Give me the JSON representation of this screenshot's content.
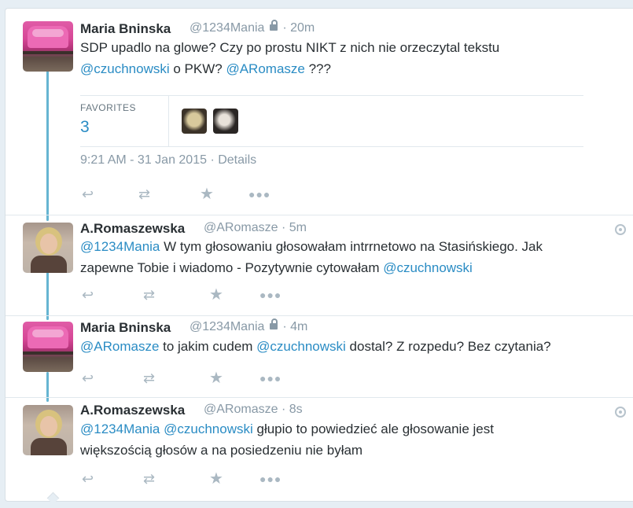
{
  "tweets": [
    {
      "name": "Maria Bninska",
      "handle": "@1234Mania",
      "time": "· 20m",
      "text": [
        {
          "t": "SDP upadlo na glowe? Czy po prostu NIKT z nich nie orzeczytal tekstu ",
          "m": false
        },
        {
          "t": "@czuchnowski",
          "m": true
        },
        {
          "t": " o PKW? ",
          "m": false
        },
        {
          "t": "@ARomasze",
          "m": true
        },
        {
          "t": " ???",
          "m": false
        }
      ],
      "favorites_label": "FAVORITES",
      "favorites_count": "3",
      "timestamp": "9:21 AM - 31 Jan 2015",
      "details": "· Details"
    },
    {
      "name": "A.Romaszewska",
      "handle": "@ARomasze",
      "time": "· 5m",
      "text_line1": [
        {
          "t": "@1234Mania",
          "m": true
        },
        {
          "t": " W tym głosowaniu głosowałam intrrnetowo na Stasińskiego.  Jak",
          "m": false
        }
      ],
      "text_line2": [
        {
          "t": "zapewne Tobie i  wiadomo - Pozytywnie cytowałam ",
          "m": false
        },
        {
          "t": "@czuchnowski",
          "m": true
        }
      ]
    },
    {
      "name": "Maria Bninska",
      "handle": "@1234Mania",
      "time": "· 4m",
      "text": [
        {
          "t": "@ARomasze",
          "m": true
        },
        {
          "t": " to jakim cudem ",
          "m": false
        },
        {
          "t": "@czuchnowski",
          "m": true
        },
        {
          "t": " dostal? Z rozpedu? Bez czytania?",
          "m": false
        }
      ]
    },
    {
      "name": "A.Romaszewska",
      "handle": "@ARomasze",
      "time": "· 8s",
      "text_line1": [
        {
          "t": "@1234Mania",
          "m": true
        },
        {
          "t": " ",
          "m": false
        },
        {
          "t": "@czuchnowski",
          "m": true
        },
        {
          "t": " głupio to powiedzieć ale głosowanie jest",
          "m": false
        }
      ],
      "text_line2": [
        {
          "t": "większością głosów a na posiedzeniu nie byłam",
          "m": false
        }
      ]
    }
  ],
  "icons": {
    "reply": "reply-icon",
    "retweet": "retweet-icon",
    "favorite": "star-icon",
    "more": "more-icon",
    "lock": "lock-icon",
    "globe": "globe-icon"
  },
  "colors": {
    "link": "#2a8cc4",
    "thread": "#66b5d2",
    "muted": "#8899a6"
  }
}
